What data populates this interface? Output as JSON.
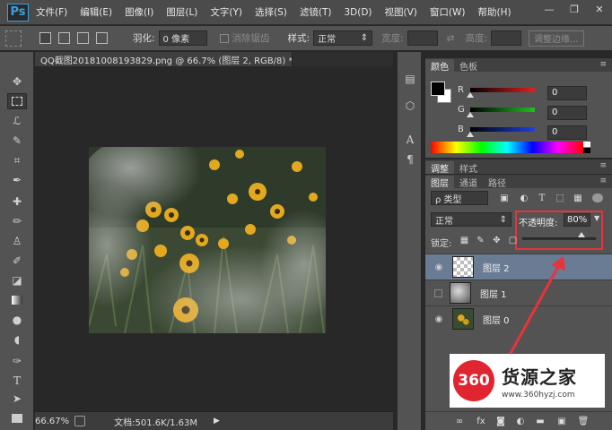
{
  "app": {
    "logo": "Ps"
  },
  "menu": [
    "文件(F)",
    "编辑(E)",
    "图像(I)",
    "图层(L)",
    "文字(Y)",
    "选择(S)",
    "滤镜(T)",
    "3D(D)",
    "视图(V)",
    "窗口(W)",
    "帮助(H)"
  ],
  "window_controls": {
    "minimize": "—",
    "restore": "❐",
    "close": "✕"
  },
  "options": {
    "feather_label": "羽化:",
    "feather_value": "0 像素",
    "antialias_label": "消除锯齿",
    "style_label": "样式:",
    "style_value": "正常",
    "width_label": "宽度:",
    "height_label": "高度:",
    "refine_edge": "调整边缘..."
  },
  "document": {
    "tab_title": "QQ截图20181008193829.png @ 66.7% (图层 2, RGB/8) *",
    "close": "×"
  },
  "status": {
    "zoom": "66.67%",
    "doc_info": "文档:501.6K/1.63M",
    "arrow": "▶"
  },
  "color_panel": {
    "tabs": [
      "颜色",
      "色板"
    ],
    "sliders": [
      {
        "label": "R",
        "value": "0",
        "color": "#e02020"
      },
      {
        "label": "G",
        "value": "0",
        "color": "#20c020"
      },
      {
        "label": "B",
        "value": "0",
        "color": "#2040e0"
      }
    ]
  },
  "adjust_panel": {
    "tabs": [
      "调整",
      "样式"
    ]
  },
  "layers_panel": {
    "tabs": [
      "图层",
      "通道",
      "路径"
    ],
    "filter_label": "ρ 类型",
    "blend_mode": "正常",
    "opacity_label": "不透明度:",
    "opacity_value": "80%",
    "opacity_fraction": 0.8,
    "lock_label": "锁定:",
    "layers": [
      {
        "name": "图层 2",
        "selected": true,
        "visible": true,
        "thumb": "checker"
      },
      {
        "name": "图层 1",
        "selected": false,
        "visible": false,
        "thumb": "cloud"
      },
      {
        "name": "图层 0",
        "selected": false,
        "visible": true,
        "thumb": "flower"
      }
    ]
  },
  "watermark": {
    "logo": "360",
    "title": "货源之家",
    "url": "www.360hyzj.com"
  },
  "colors": {
    "annotation_red": "#e8333a",
    "selected_layer": "#6a7b94"
  }
}
